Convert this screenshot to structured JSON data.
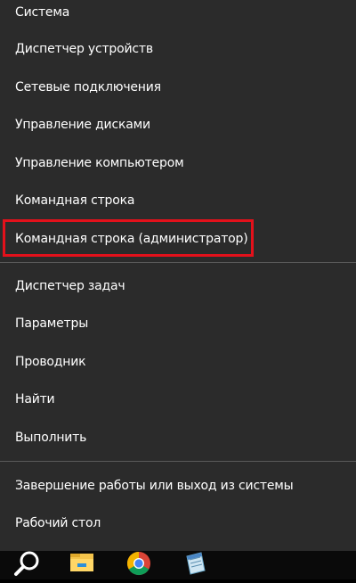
{
  "menu": {
    "items": [
      {
        "label": "Система"
      },
      {
        "label": "Диспетчер устройств"
      },
      {
        "label": "Сетевые подключения"
      },
      {
        "label": "Управление дисками"
      },
      {
        "label": "Управление компьютером"
      },
      {
        "label": "Командная строка"
      },
      {
        "label": "Командная строка (администратор)"
      },
      {
        "label": "Диспетчер задач"
      },
      {
        "label": "Параметры"
      },
      {
        "label": "Проводник"
      },
      {
        "label": "Найти"
      },
      {
        "label": "Выполнить"
      },
      {
        "label": "Завершение работы или выход из системы"
      },
      {
        "label": "Рабочий стол"
      }
    ],
    "highlighted_item": "Командная строка (администратор)",
    "highlight_color": "#e3111b",
    "background_color": "#2b2b2b",
    "text_color": "#ffffff"
  },
  "taskbar": {
    "icons": [
      {
        "name": "search-icon"
      },
      {
        "name": "file-explorer-icon"
      },
      {
        "name": "chrome-icon"
      },
      {
        "name": "notepad-icon"
      }
    ]
  }
}
